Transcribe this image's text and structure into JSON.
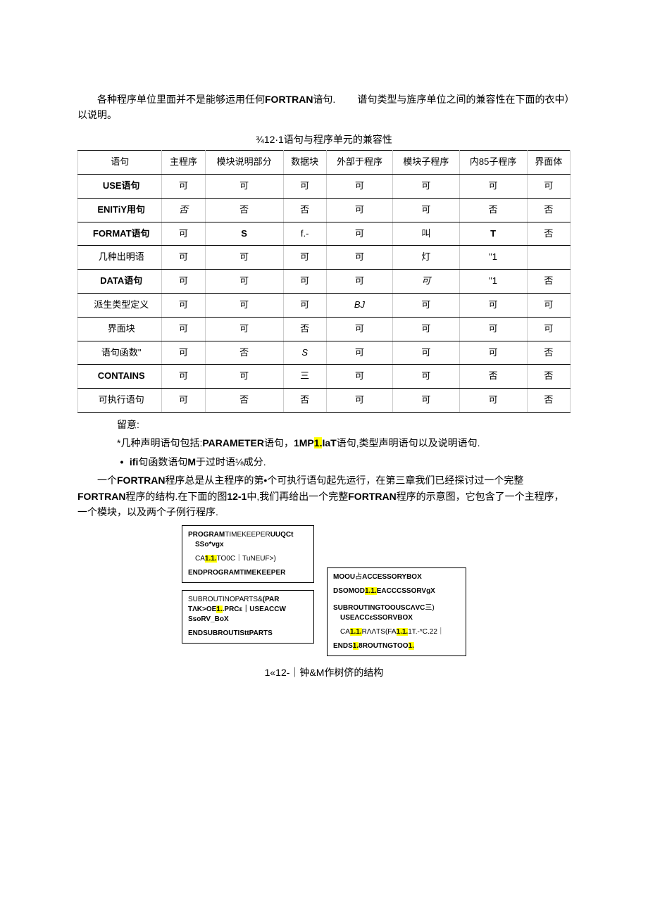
{
  "intro": {
    "p1a": "各种程序单位里面并不是能够运用任何",
    "p1b": "FORTRAN",
    "p1c": "谙句.",
    "p1d": "谱句类型与旌序单位之间的兼容性在下面的衣中）以说明。"
  },
  "table": {
    "title": "¾12·1语句与程序单元的兼容性",
    "headers": [
      "语句",
      "主程序",
      "模块说明部分",
      "数据块",
      "外部于程序",
      "模块子程序",
      "内85子程序",
      "界面体"
    ],
    "rows": [
      {
        "label": "USE语句",
        "bold": true,
        "cells": [
          "可",
          "可",
          "可",
          "可",
          "可",
          "可",
          "可"
        ]
      },
      {
        "label": "ENITiY用句",
        "bold": true,
        "cells": [
          "否",
          "否",
          "否",
          "可",
          "可",
          "否",
          "否"
        ],
        "italic0": true
      },
      {
        "label": "FORMAT语句",
        "bold": true,
        "cells": [
          "可",
          "S",
          "f.-",
          "可",
          "叫",
          "T",
          "否"
        ],
        "bold14": true
      },
      {
        "label": "几种出明语",
        "bold": false,
        "cells": [
          "可",
          "可",
          "可",
          "可",
          "灯",
          "\"1",
          ""
        ]
      },
      {
        "label": "DATA语句",
        "bold": true,
        "cells": [
          "可",
          "可",
          "可",
          "可",
          "可",
          "\"1",
          "否"
        ],
        "italic4": true
      },
      {
        "label": "派生类型定义",
        "bold": false,
        "cells": [
          "可",
          "可",
          "可",
          "BJ",
          "可",
          "可",
          "可"
        ],
        "italic3": true
      },
      {
        "label": "界面块",
        "bold": false,
        "cells": [
          "可",
          "可",
          "否",
          "可",
          "可",
          "可",
          "可"
        ]
      },
      {
        "label": "语句函数\"",
        "bold": false,
        "cells": [
          "可",
          "否",
          "S",
          "可",
          "可",
          "可",
          "否"
        ],
        "italic2": true
      },
      {
        "label": "CONTAINS",
        "bold": true,
        "cells": [
          "可",
          "可",
          "三",
          "可",
          "可",
          "否",
          "否"
        ]
      },
      {
        "label": "可执行语句",
        "bold": false,
        "cells": [
          "可",
          "否",
          "否",
          "可",
          "可",
          "可",
          "否"
        ]
      }
    ]
  },
  "notes": {
    "l0": "留意:",
    "l1a": "*几种声明语句包括:",
    "l1b": "PARAMETER",
    "l1c": "语句，",
    "l1d": "1MP",
    "l1e": "1.",
    "l1f": "IaT",
    "l1g": "语句,类型声明语句以及说明语句.",
    "l2a": "ifi",
    "l2b": "句函数语句",
    "l2c": "M",
    "l2d": "于过时语⅛成分."
  },
  "body": {
    "s1": "一个",
    "s2": "FORTRAN",
    "s3": "程序总是从主程序的第•个可执行语句起先运行，在第三章我们已经探讨过一个完整",
    "s4": "FORTRAN",
    "s5": "程序的结构.在下面的图",
    "s6": "12-1",
    "s7": "中,我们再给出一个完整",
    "s8": "FORTRAN",
    "s9": "程序的示意图，它包含了一个主程序，一个模块，以及两个子例行程序."
  },
  "diagram": {
    "b1": {
      "l1a": "PROGRAM",
      "l1b": "TIMEKEEPER",
      "l1c": "UUQCt",
      "l2": "SSo*vgx",
      "l3a": "CA",
      "l3h": "1.1.",
      "l3b": "TO0C｜TuNEUF>)",
      "l4a": "ENDPROGRAM",
      "l4b": "TIMEKEEPER"
    },
    "b2": {
      "l1a": "S",
      "l1b": "UBROUTINO",
      "l1c": "PARTS&",
      "l1d": "(PAR",
      "l2a": "TΛK>OE",
      "l2h": "1.",
      "l2b": ".PRCε｜USEACCW",
      "l3": "SsoRV_BoX",
      "l4": "ENDSUBROUTISttPARTS"
    },
    "b3": {
      "l1a": "MOOU",
      "l1b": "占",
      "l1c": "ACCESSORYBOX",
      "l2a": "DSOMOD",
      "l2h": "1.1.",
      "l2b": "EACCCSSORVgX",
      "l3a": "SUBROUTINGTOOUSCΛVC",
      "l3b": "三)",
      "l4": "USEΛCCεSSORVBOX",
      "l5a": "CA",
      "l5h1": "1.1.",
      "l5b": "RΛΛTS(FA",
      "l5h2": "1.1.",
      "l5c": "1T.-*C.22｜",
      "l6a": "ENDS",
      "l6h": "1.",
      "l6b": "8ROUTNGTOO",
      "l6h2": "1."
    }
  },
  "caption": "1«12-｜钟&M作树侪的结构"
}
